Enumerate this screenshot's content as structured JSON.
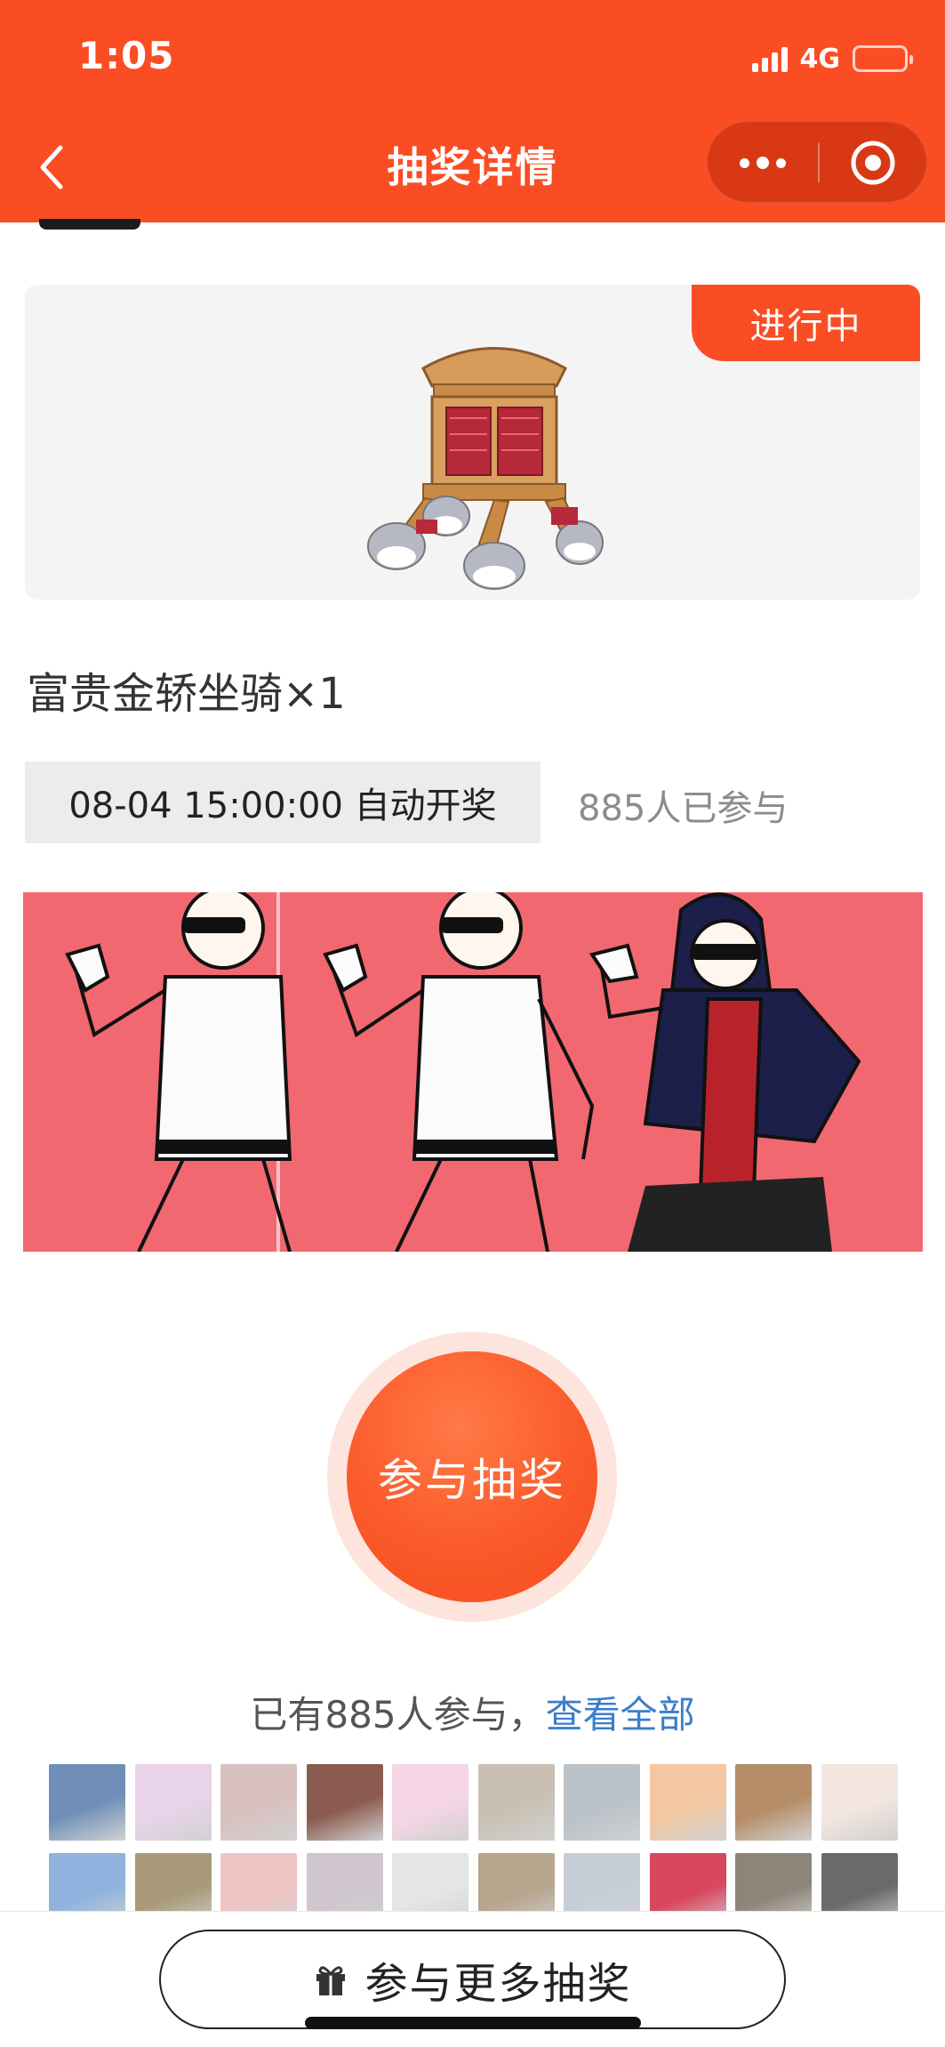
{
  "status_bar": {
    "time": "1:05",
    "network": "4G"
  },
  "nav": {
    "title": "抽奖详情"
  },
  "prize": {
    "status": "进行中",
    "name": "富贵金轿坐骑×1",
    "draw_time": "08-04 15:00:00 自动开奖",
    "participant_count": "885人已参与"
  },
  "join": {
    "label": "参与抽奖"
  },
  "participants": {
    "summary": "已有885人参与，",
    "view_all": "查看全部",
    "avatars": [
      "#6f8fb8",
      "#e9d3ea",
      "#d8c1bf",
      "#8a5b4e",
      "#f6d6e6",
      "#c9c0b3",
      "#b9c1c9",
      "#f3c7a1",
      "#b58d68",
      "#f2e6df",
      "#8fb3de",
      "#a89a78",
      "#efc5c3",
      "#cfc6cf",
      "#e5e5e5",
      "#b7a58e",
      "#c6cfd8",
      "#d9475f",
      "#8d857a",
      "#6a6a6a"
    ]
  },
  "bottom": {
    "more_label": "参与更多抽奖"
  }
}
